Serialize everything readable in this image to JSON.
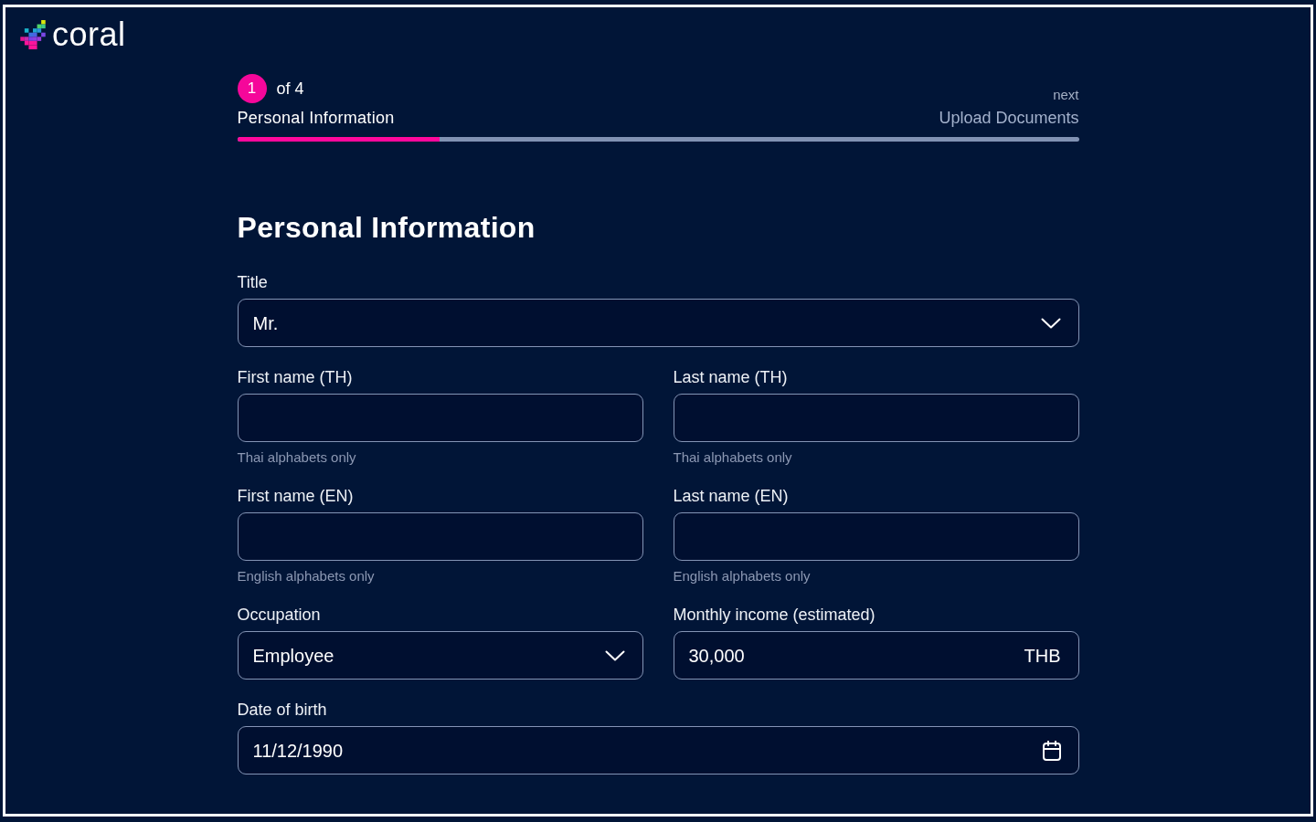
{
  "brand": {
    "name": "coral"
  },
  "stepper": {
    "number": "1",
    "count": "of 4",
    "title": "Personal Information",
    "next_caption": "next",
    "next_title": "Upload Documents",
    "progress": {
      "level": 0.24
    }
  },
  "form": {
    "heading": "Personal Information",
    "rows": [
      [
        {
          "kind": "select",
          "label": "Title",
          "value": "Mr."
        }
      ],
      [
        {
          "kind": "text",
          "label": "First name (TH)",
          "help": "Thai alphabets only"
        },
        {
          "kind": "text",
          "label": "Last name (TH)",
          "help": "Thai alphabets only"
        }
      ],
      [
        {
          "kind": "text",
          "label": "First name (EN)",
          "help": "English alphabets only"
        },
        {
          "kind": "text",
          "label": "Last name (EN)",
          "help": "English alphabets only"
        }
      ],
      [
        {
          "kind": "select",
          "label": "Occupation",
          "value": "Employee"
        },
        {
          "kind": "amount",
          "label": "Monthly income (estimated)",
          "value": "30,000",
          "unit": "THB"
        }
      ],
      [
        {
          "kind": "date",
          "label": "Date of birth",
          "value": "11/12/1990"
        }
      ]
    ]
  }
}
